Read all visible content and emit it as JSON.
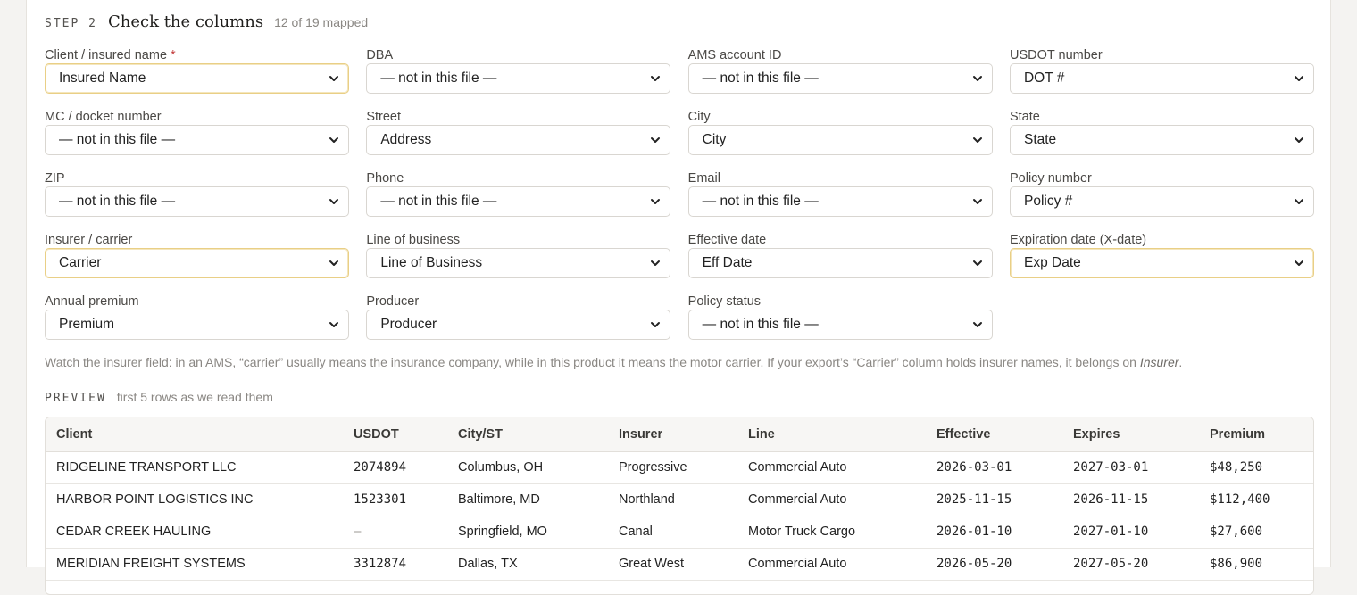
{
  "step": {
    "kicker": "STEP 2",
    "title": "Check the columns",
    "count": "12 of 19 mapped"
  },
  "fields": [
    {
      "label": "Client / insured name",
      "required": true,
      "value": "Insured Name",
      "warn": true
    },
    {
      "label": "DBA",
      "value": "— not in this file —"
    },
    {
      "label": "AMS account ID",
      "value": "— not in this file —"
    },
    {
      "label": "USDOT number",
      "value": "DOT #"
    },
    {
      "label": "MC / docket number",
      "value": "— not in this file —"
    },
    {
      "label": "Street",
      "value": "Address"
    },
    {
      "label": "City",
      "value": "City"
    },
    {
      "label": "State",
      "value": "State"
    },
    {
      "label": "ZIP",
      "value": "— not in this file —"
    },
    {
      "label": "Phone",
      "value": "— not in this file —"
    },
    {
      "label": "Email",
      "value": "— not in this file —"
    },
    {
      "label": "Policy number",
      "value": "Policy #"
    },
    {
      "label": "Insurer / carrier",
      "value": "Carrier",
      "warn": true
    },
    {
      "label": "Line of business",
      "value": "Line of Business"
    },
    {
      "label": "Effective date",
      "value": "Eff Date"
    },
    {
      "label": "Expiration date (X-date)",
      "value": "Exp Date",
      "warn": true
    },
    {
      "label": "Annual premium",
      "value": "Premium"
    },
    {
      "label": "Producer",
      "value": "Producer"
    },
    {
      "label": "Policy status",
      "value": "— not in this file —"
    }
  ],
  "note": {
    "text": "Watch the insurer field: in an AMS, “carrier” usually means the insurance company, while in this product it means the motor carrier. If your export’s “Carrier” column holds insurer names, it belongs on ",
    "emphasis": "Insurer",
    "tail": "."
  },
  "preview": {
    "kicker": "PREVIEW",
    "subtitle": "first 5 rows as we read them",
    "columns": [
      "Client",
      "USDOT",
      "City/ST",
      "Insurer",
      "Line",
      "Effective",
      "Expires",
      "Premium"
    ],
    "rows": [
      [
        "RIDGELINE TRANSPORT LLC",
        "2074894",
        "Columbus, OH",
        "Progressive",
        "Commercial Auto",
        "2026-03-01",
        "2027-03-01",
        "$48,250"
      ],
      [
        "HARBOR POINT LOGISTICS INC",
        "1523301",
        "Baltimore, MD",
        "Northland",
        "Commercial Auto",
        "2025-11-15",
        "2026-11-15",
        "$112,400"
      ],
      [
        "CEDAR CREEK HAULING",
        "–",
        "Springfield, MO",
        "Canal",
        "Motor Truck Cargo",
        "2026-01-10",
        "2027-01-10",
        "$27,600"
      ],
      [
        "MERIDIAN FREIGHT SYSTEMS",
        "3312874",
        "Dallas, TX",
        "Great West",
        "Commercial Auto",
        "2026-05-20",
        "2027-05-20",
        "$86,900"
      ]
    ]
  }
}
